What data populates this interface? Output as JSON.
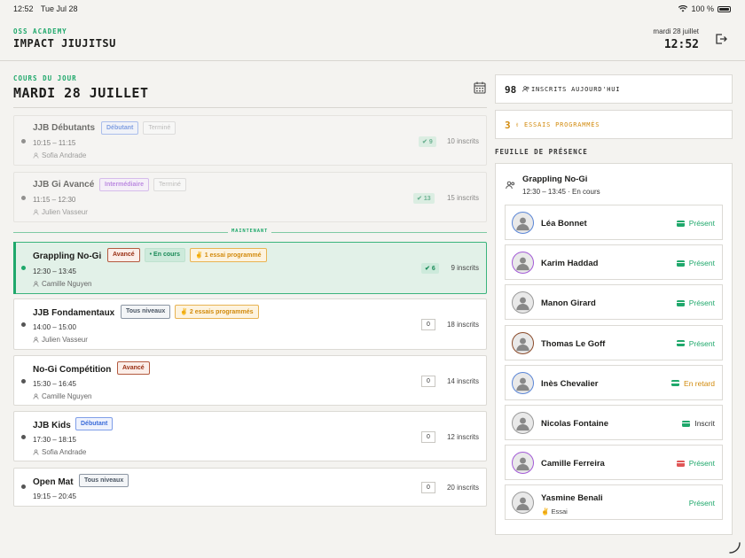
{
  "status_bar": {
    "time": "12:52",
    "date": "Tue Jul 28",
    "battery": "100 %"
  },
  "header": {
    "academy": "OSS ACADEMY",
    "school": "IMPACT JIUJITSU",
    "date": "mardi 28 juillet",
    "time": "12:52"
  },
  "day": {
    "label": "COURS DU JOUR",
    "title": "MARDI 28 JUILLET"
  },
  "now_label": "MAINTENANT",
  "sessions": [
    {
      "name": "JJB Débutants",
      "level": "Débutant",
      "status": "Terminé",
      "time": "10:15 – 11:15",
      "coach": "Sofia Andrade",
      "present": "9",
      "inscrits": "10 inscrits"
    },
    {
      "name": "JJB Gi Avancé",
      "level": "Intermédiaire",
      "status": "Terminé",
      "time": "11:15 – 12:30",
      "coach": "Julien Vasseur",
      "present": "13",
      "inscrits": "15 inscrits"
    },
    {
      "name": "Grappling No-Gi",
      "level": "Avancé",
      "status": "• En cours",
      "trial": "1 essai programmé",
      "time": "12:30 – 13:45",
      "coach": "Camille Nguyen",
      "present": "6",
      "inscrits": "9 inscrits"
    },
    {
      "name": "JJB Fondamentaux",
      "level": "Tous niveaux",
      "trial": "2 essais programmés",
      "time": "14:00 – 15:00",
      "coach": "Julien Vasseur",
      "present": "0",
      "inscrits": "18 inscrits"
    },
    {
      "name": "No-Gi Compétition",
      "level": "Avancé",
      "time": "15:30 – 16:45",
      "coach": "Camille Nguyen",
      "present": "0",
      "inscrits": "14 inscrits"
    },
    {
      "name": "JJB Kids",
      "level": "Débutant",
      "time": "17:30 – 18:15",
      "coach": "Sofia Andrade",
      "present": "0",
      "inscrits": "12 inscrits"
    },
    {
      "name": "Open Mat",
      "level": "Tous niveaux",
      "time": "19:15 – 20:45",
      "present": "0",
      "inscrits": "20 inscrits"
    }
  ],
  "stats": {
    "inscrits": {
      "value": "98",
      "label": "INSCRITS AUJOURD'HUI"
    },
    "essais": {
      "value": "3",
      "label": "ESSAIS PROGRAMMÉS"
    }
  },
  "sheet": {
    "title": "FEUILLE DE PRÉSENCE",
    "session_name": "Grappling No-Gi",
    "session_sub": "12:30 – 13:45 · En cours",
    "attendees": [
      {
        "name": "Léa Bonnet",
        "status": "Présent",
        "ring": "#5b86d6"
      },
      {
        "name": "Karim Haddad",
        "status": "Présent",
        "ring": "#a35bd6"
      },
      {
        "name": "Manon Girard",
        "status": "Présent",
        "ring": "#9a9a9a"
      },
      {
        "name": "Thomas Le Goff",
        "status": "Présent",
        "ring": "#8a4a2a"
      },
      {
        "name": "Inès Chevalier",
        "status": "En retard",
        "ring": "#5b86d6"
      },
      {
        "name": "Nicolas Fontaine",
        "status": "Inscrit",
        "ring": "#9a9a9a"
      },
      {
        "name": "Camille Ferreira",
        "status": "Présent",
        "ring": "#a35bd6"
      },
      {
        "name": "Yasmine Benali",
        "sub": "Essai",
        "status": "Présent",
        "ring": "#9a9a9a"
      }
    ]
  },
  "colors": {
    "accent": "#1fa86b",
    "trial": "#d28a0c",
    "late": "#d28a0c",
    "card_red": "#e05656"
  }
}
